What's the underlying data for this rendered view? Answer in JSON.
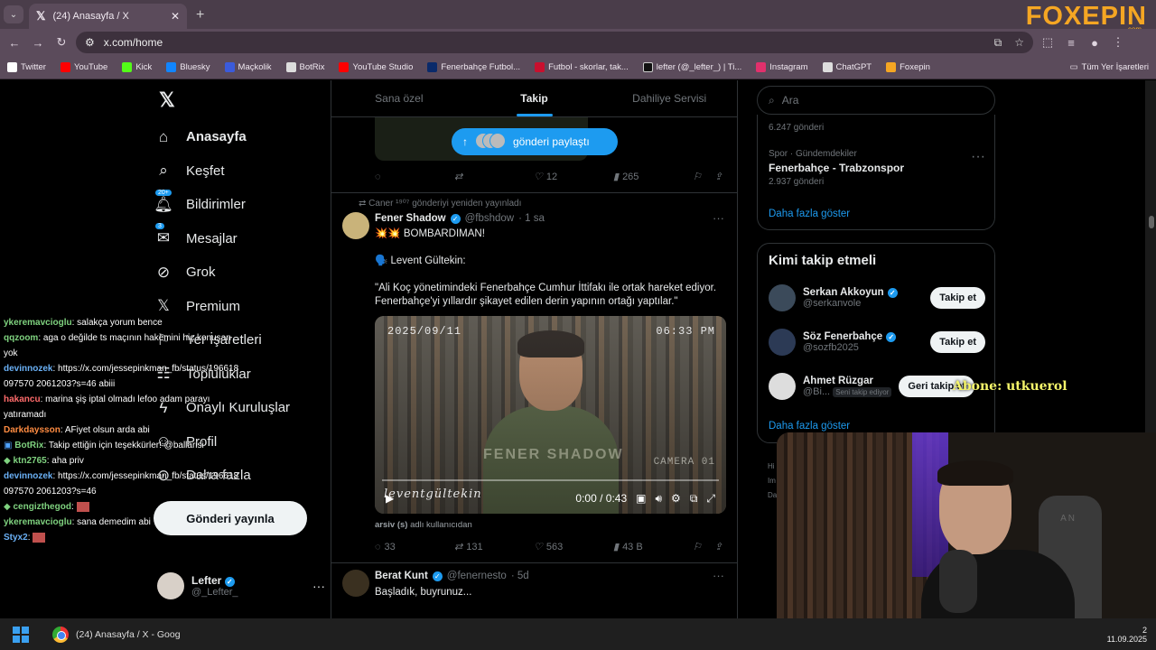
{
  "browser": {
    "tab_title": "(24) Anasayfa / X",
    "new_tab": "+",
    "url": "x.com/home",
    "logo_text": "FOXEPIN",
    "logo_sub": ".com",
    "bookmarks": [
      {
        "label": "Twitter",
        "color": "#ffffff"
      },
      {
        "label": "YouTube",
        "color": "#ff0000"
      },
      {
        "label": "Kick",
        "color": "#53fc18"
      },
      {
        "label": "Bluesky",
        "color": "#1185fe"
      },
      {
        "label": "Maçkolik",
        "color": "#3b5bdb"
      },
      {
        "label": "BotRix",
        "color": "#dddddd"
      },
      {
        "label": "YouTube Studio",
        "color": "#ff0000"
      },
      {
        "label": "Fenerbahçe Futbol...",
        "color": "#0a2a6a"
      },
      {
        "label": "Futbol - skorlar, tak...",
        "color": "#c8102e"
      },
      {
        "label": "lefter (@_lefter_) | Ti...",
        "color": "#111111"
      },
      {
        "label": "Instagram",
        "color": "#e1306c"
      },
      {
        "label": "ChatGPT",
        "color": "#dddddd"
      },
      {
        "label": "Foxepin",
        "color": "#f5a623"
      }
    ],
    "bookmarks_all": "Tüm Yer İşaretleri"
  },
  "nav": {
    "items": [
      {
        "label": "Anasayfa",
        "icon": "home-icon"
      },
      {
        "label": "Keşfet",
        "icon": "search-icon"
      },
      {
        "label": "Bildirimler",
        "icon": "bell-icon",
        "badge": "20+"
      },
      {
        "label": "Mesajlar",
        "icon": "mail-icon",
        "badge": "3"
      },
      {
        "label": "Grok",
        "icon": "grok-icon"
      },
      {
        "label": "Premium",
        "icon": "x-icon"
      },
      {
        "label": "Yer İşaretleri",
        "icon": "bookmark-icon"
      },
      {
        "label": "Topluluklar",
        "icon": "people-icon"
      },
      {
        "label": "Onaylı Kuruluşlar",
        "icon": "lightning-icon"
      },
      {
        "label": "Profil",
        "icon": "user-icon"
      },
      {
        "label": "Daha fazla",
        "icon": "more-icon"
      }
    ],
    "post_label": "Gönderi yayınla",
    "profile_name": "Lefter",
    "profile_handle": "@_Lefter_"
  },
  "chat": [
    {
      "user": "ykeremavcioglu",
      "color": "#7fd27f",
      "text": ": salakça yorum bence"
    },
    {
      "user": "qqzoom",
      "color": "#7fd27f",
      "text": ": aga o değilde ts maçının hakemini hiç konuşan yok"
    },
    {
      "user": "devinnozek",
      "color": "#6ab0f5",
      "text": ": https://x.com/jessepinkman_fb/status/196618097570 2061203?s=46 abiii"
    },
    {
      "user": "hakancu",
      "color": "#ff6b6b",
      "text": ": marina şiş iptal olmadı lefoo adam parayı yatıramadı"
    },
    {
      "user": "Darkdaysson",
      "color": "#ff8c42",
      "text": ": AFiyet olsun arda abi"
    },
    {
      "user": "BotRix",
      "color": "#7fd27f",
      "text": ": Takip ettiğin için teşekkürler! @ballarisi"
    },
    {
      "user": "ktn2765",
      "color": "#7fd27f",
      "text": ": aha priv"
    },
    {
      "user": "devinnozek",
      "color": "#6ab0f5",
      "text": ": https://x.com/jessepinkman_fb/status/196618097570 2061203?s=46"
    },
    {
      "user": "cengizthegod",
      "color": "#7fd27f",
      "text": ":"
    },
    {
      "user": "ykeremavcioglu",
      "color": "#7fd27f",
      "text": ": sana demedim abi"
    },
    {
      "user": "Styx2",
      "color": "#6ab0f5",
      "text": ":"
    }
  ],
  "timeline": {
    "tabs": [
      "Sana özel",
      "Takip",
      "Dahiliye Servisi"
    ],
    "new_posts_label": "gönderi paylaştı",
    "post0": {
      "replies": "",
      "retweets": "",
      "likes": "12",
      "views": "265"
    },
    "post1": {
      "retweet_note": "Caner ¹⁹⁰⁷ gönderiyi yeniden yayınladı",
      "name": "Fener Shadow",
      "handle": "@fbshdow",
      "time": "· 1 sa",
      "line1": "💥💥 BOMBARDIMAN!",
      "line2": "🗣️ Levent Gültekin:",
      "line3": "\"Ali Koç yönetimindeki Fenerbahçe Cumhur İttifakı ile ortak hareket ediyor. Fenerbahçe'yi yıllardır şikayet edilen derin yapının ortağı yaptılar.\"",
      "video_date": "2025/09/11",
      "video_time": "06:33 PM",
      "video_watermark": "FENER SHADOW",
      "video_cam": "CAMERA 01",
      "video_brand": "leventgültekin",
      "video_timer": "0:00 / 0:43",
      "credit": "arsiv (s)",
      "credit_suffix": "adlı kullanıcıdan",
      "replies": "33",
      "retweets": "131",
      "likes": "563",
      "views": "43 B"
    },
    "post2": {
      "name": "Berat Kunt",
      "handle": "@fenernesto",
      "time": "· 5d",
      "text": "Başladık, buyrunuz..."
    }
  },
  "right": {
    "search_placeholder": "Ara",
    "trend_prev_count": "6.247 gönderi",
    "trend_category": "Spor · Gündemdekiler",
    "trend_title": "Fenerbahçe - Trabzonspor",
    "trend_count": "2.937 gönderi",
    "show_more": "Daha fazla göster",
    "who_title": "Kimi takip etmeli",
    "who": [
      {
        "name": "Serkan Akkoyun",
        "handle": "@serkanvole",
        "button": "Takip et"
      },
      {
        "name": "Söz Fenerbahçe",
        "handle": "@sozfb2025",
        "button": "Takip et"
      },
      {
        "name": "Ahmet Rüzgar",
        "handle": "@Bi...",
        "note": "Seni takip ediyor",
        "button": "Geri takip et"
      }
    ],
    "show_more2": "Daha fazla göster",
    "footer_partial": [
      "Hi",
      "Im",
      "Da"
    ]
  },
  "overlay": {
    "subscribe_text": "Abone: utkuerol",
    "webcam_letters": "AN"
  },
  "taskbar": {
    "window_title": "(24) Anasayfa / X - Goog",
    "date": "11.09.2025",
    "time_partial": "2"
  }
}
